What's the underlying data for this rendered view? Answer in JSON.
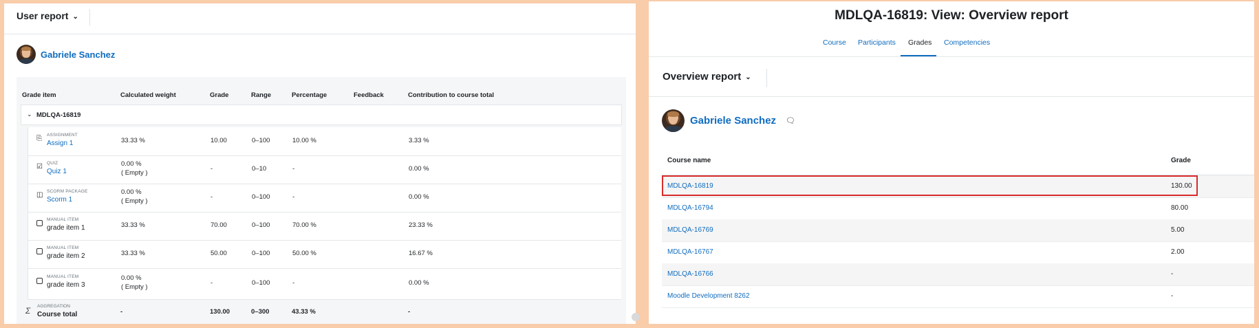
{
  "user_report": {
    "title": "User report",
    "user_name": "Gabriele Sanchez",
    "columns": [
      "Grade item",
      "Calculated weight",
      "Grade",
      "Range",
      "Percentage",
      "Feedback",
      "Contribution to course total"
    ],
    "category": "MDLQA-16819",
    "items": [
      {
        "type": "ASSIGNMENT",
        "name": "Assign 1",
        "icon": "assignment-icon",
        "weight": "33.33 %",
        "weight_note": "",
        "grade": "10.00",
        "range": "0–100",
        "percentage": "10.00 %",
        "contribution": "3.33 %"
      },
      {
        "type": "QUIZ",
        "name": "Quiz 1",
        "icon": "quiz-icon",
        "weight": "0.00 %",
        "weight_note": "( Empty )",
        "grade": "-",
        "range": "0–10",
        "percentage": "-",
        "contribution": "0.00 %"
      },
      {
        "type": "SCORM PACKAGE",
        "name": "Scorm 1",
        "icon": "scorm-package-icon",
        "weight": "0.00 %",
        "weight_note": "( Empty )",
        "grade": "-",
        "range": "0–100",
        "percentage": "-",
        "contribution": "0.00 %"
      },
      {
        "type": "MANUAL ITEM",
        "name": "grade item 1",
        "icon": "manual-item-icon",
        "weight": "33.33 %",
        "weight_note": "",
        "grade": "70.00",
        "range": "0–100",
        "percentage": "70.00 %",
        "contribution": "23.33 %"
      },
      {
        "type": "MANUAL ITEM",
        "name": "grade item 2",
        "icon": "manual-item-icon",
        "weight": "33.33 %",
        "weight_note": "",
        "grade": "50.00",
        "range": "0–100",
        "percentage": "50.00 %",
        "contribution": "16.67 %"
      },
      {
        "type": "MANUAL ITEM",
        "name": "grade item 3",
        "icon": "manual-item-icon",
        "weight": "0.00 %",
        "weight_note": "( Empty )",
        "grade": "-",
        "range": "0–100",
        "percentage": "-",
        "contribution": "0.00 %"
      }
    ],
    "total": {
      "type": "AGGREGATION",
      "name": "Course total",
      "weight": "-",
      "grade": "130.00",
      "range": "0–300",
      "percentage": "43.33 %",
      "contribution": "-"
    }
  },
  "overview": {
    "page_title": "MDLQA-16819: View: Overview report",
    "tabs": [
      "Course",
      "Participants",
      "Grades",
      "Competencies"
    ],
    "active_tab": "Grades",
    "report_title": "Overview report",
    "user_name": "Gabriele Sanchez",
    "columns": [
      "Course name",
      "Grade"
    ],
    "rows": [
      {
        "course": "MDLQA-16819",
        "grade": "130.00"
      },
      {
        "course": "MDLQA-16794",
        "grade": "80.00"
      },
      {
        "course": "MDLQA-16769",
        "grade": "5.00"
      },
      {
        "course": "MDLQA-16767",
        "grade": "2.00"
      },
      {
        "course": "MDLQA-16766",
        "grade": "-"
      },
      {
        "course": "Moodle Development 8262",
        "grade": "-"
      }
    ],
    "highlighted_row": "MDLQA-16819",
    "highlight_color": "#d92b2b"
  },
  "colors": {
    "link": "#0f6cbf",
    "background": "#f9ccaa"
  }
}
